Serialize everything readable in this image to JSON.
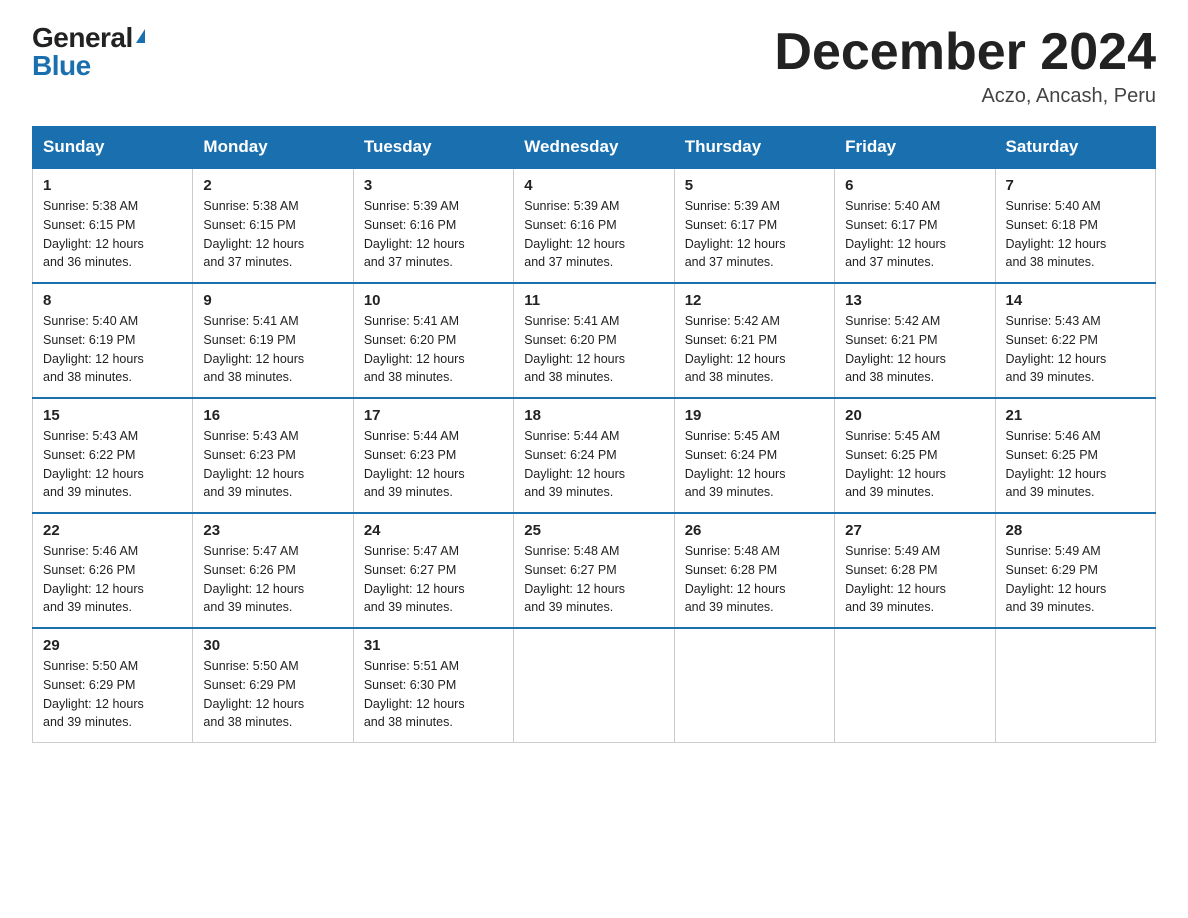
{
  "logo": {
    "general": "General",
    "blue": "Blue"
  },
  "title": "December 2024",
  "subtitle": "Aczo, Ancash, Peru",
  "days_of_week": [
    "Sunday",
    "Monday",
    "Tuesday",
    "Wednesday",
    "Thursday",
    "Friday",
    "Saturday"
  ],
  "weeks": [
    [
      {
        "day": "1",
        "sunrise": "5:38 AM",
        "sunset": "6:15 PM",
        "daylight": "12 hours and 36 minutes."
      },
      {
        "day": "2",
        "sunrise": "5:38 AM",
        "sunset": "6:15 PM",
        "daylight": "12 hours and 37 minutes."
      },
      {
        "day": "3",
        "sunrise": "5:39 AM",
        "sunset": "6:16 PM",
        "daylight": "12 hours and 37 minutes."
      },
      {
        "day": "4",
        "sunrise": "5:39 AM",
        "sunset": "6:16 PM",
        "daylight": "12 hours and 37 minutes."
      },
      {
        "day": "5",
        "sunrise": "5:39 AM",
        "sunset": "6:17 PM",
        "daylight": "12 hours and 37 minutes."
      },
      {
        "day": "6",
        "sunrise": "5:40 AM",
        "sunset": "6:17 PM",
        "daylight": "12 hours and 37 minutes."
      },
      {
        "day": "7",
        "sunrise": "5:40 AM",
        "sunset": "6:18 PM",
        "daylight": "12 hours and 38 minutes."
      }
    ],
    [
      {
        "day": "8",
        "sunrise": "5:40 AM",
        "sunset": "6:19 PM",
        "daylight": "12 hours and 38 minutes."
      },
      {
        "day": "9",
        "sunrise": "5:41 AM",
        "sunset": "6:19 PM",
        "daylight": "12 hours and 38 minutes."
      },
      {
        "day": "10",
        "sunrise": "5:41 AM",
        "sunset": "6:20 PM",
        "daylight": "12 hours and 38 minutes."
      },
      {
        "day": "11",
        "sunrise": "5:41 AM",
        "sunset": "6:20 PM",
        "daylight": "12 hours and 38 minutes."
      },
      {
        "day": "12",
        "sunrise": "5:42 AM",
        "sunset": "6:21 PM",
        "daylight": "12 hours and 38 minutes."
      },
      {
        "day": "13",
        "sunrise": "5:42 AM",
        "sunset": "6:21 PM",
        "daylight": "12 hours and 38 minutes."
      },
      {
        "day": "14",
        "sunrise": "5:43 AM",
        "sunset": "6:22 PM",
        "daylight": "12 hours and 39 minutes."
      }
    ],
    [
      {
        "day": "15",
        "sunrise": "5:43 AM",
        "sunset": "6:22 PM",
        "daylight": "12 hours and 39 minutes."
      },
      {
        "day": "16",
        "sunrise": "5:43 AM",
        "sunset": "6:23 PM",
        "daylight": "12 hours and 39 minutes."
      },
      {
        "day": "17",
        "sunrise": "5:44 AM",
        "sunset": "6:23 PM",
        "daylight": "12 hours and 39 minutes."
      },
      {
        "day": "18",
        "sunrise": "5:44 AM",
        "sunset": "6:24 PM",
        "daylight": "12 hours and 39 minutes."
      },
      {
        "day": "19",
        "sunrise": "5:45 AM",
        "sunset": "6:24 PM",
        "daylight": "12 hours and 39 minutes."
      },
      {
        "day": "20",
        "sunrise": "5:45 AM",
        "sunset": "6:25 PM",
        "daylight": "12 hours and 39 minutes."
      },
      {
        "day": "21",
        "sunrise": "5:46 AM",
        "sunset": "6:25 PM",
        "daylight": "12 hours and 39 minutes."
      }
    ],
    [
      {
        "day": "22",
        "sunrise": "5:46 AM",
        "sunset": "6:26 PM",
        "daylight": "12 hours and 39 minutes."
      },
      {
        "day": "23",
        "sunrise": "5:47 AM",
        "sunset": "6:26 PM",
        "daylight": "12 hours and 39 minutes."
      },
      {
        "day": "24",
        "sunrise": "5:47 AM",
        "sunset": "6:27 PM",
        "daylight": "12 hours and 39 minutes."
      },
      {
        "day": "25",
        "sunrise": "5:48 AM",
        "sunset": "6:27 PM",
        "daylight": "12 hours and 39 minutes."
      },
      {
        "day": "26",
        "sunrise": "5:48 AM",
        "sunset": "6:28 PM",
        "daylight": "12 hours and 39 minutes."
      },
      {
        "day": "27",
        "sunrise": "5:49 AM",
        "sunset": "6:28 PM",
        "daylight": "12 hours and 39 minutes."
      },
      {
        "day": "28",
        "sunrise": "5:49 AM",
        "sunset": "6:29 PM",
        "daylight": "12 hours and 39 minutes."
      }
    ],
    [
      {
        "day": "29",
        "sunrise": "5:50 AM",
        "sunset": "6:29 PM",
        "daylight": "12 hours and 39 minutes."
      },
      {
        "day": "30",
        "sunrise": "5:50 AM",
        "sunset": "6:29 PM",
        "daylight": "12 hours and 38 minutes."
      },
      {
        "day": "31",
        "sunrise": "5:51 AM",
        "sunset": "6:30 PM",
        "daylight": "12 hours and 38 minutes."
      },
      null,
      null,
      null,
      null
    ]
  ],
  "labels": {
    "sunrise_prefix": "Sunrise: ",
    "sunset_prefix": "Sunset: ",
    "daylight_prefix": "Daylight: "
  }
}
